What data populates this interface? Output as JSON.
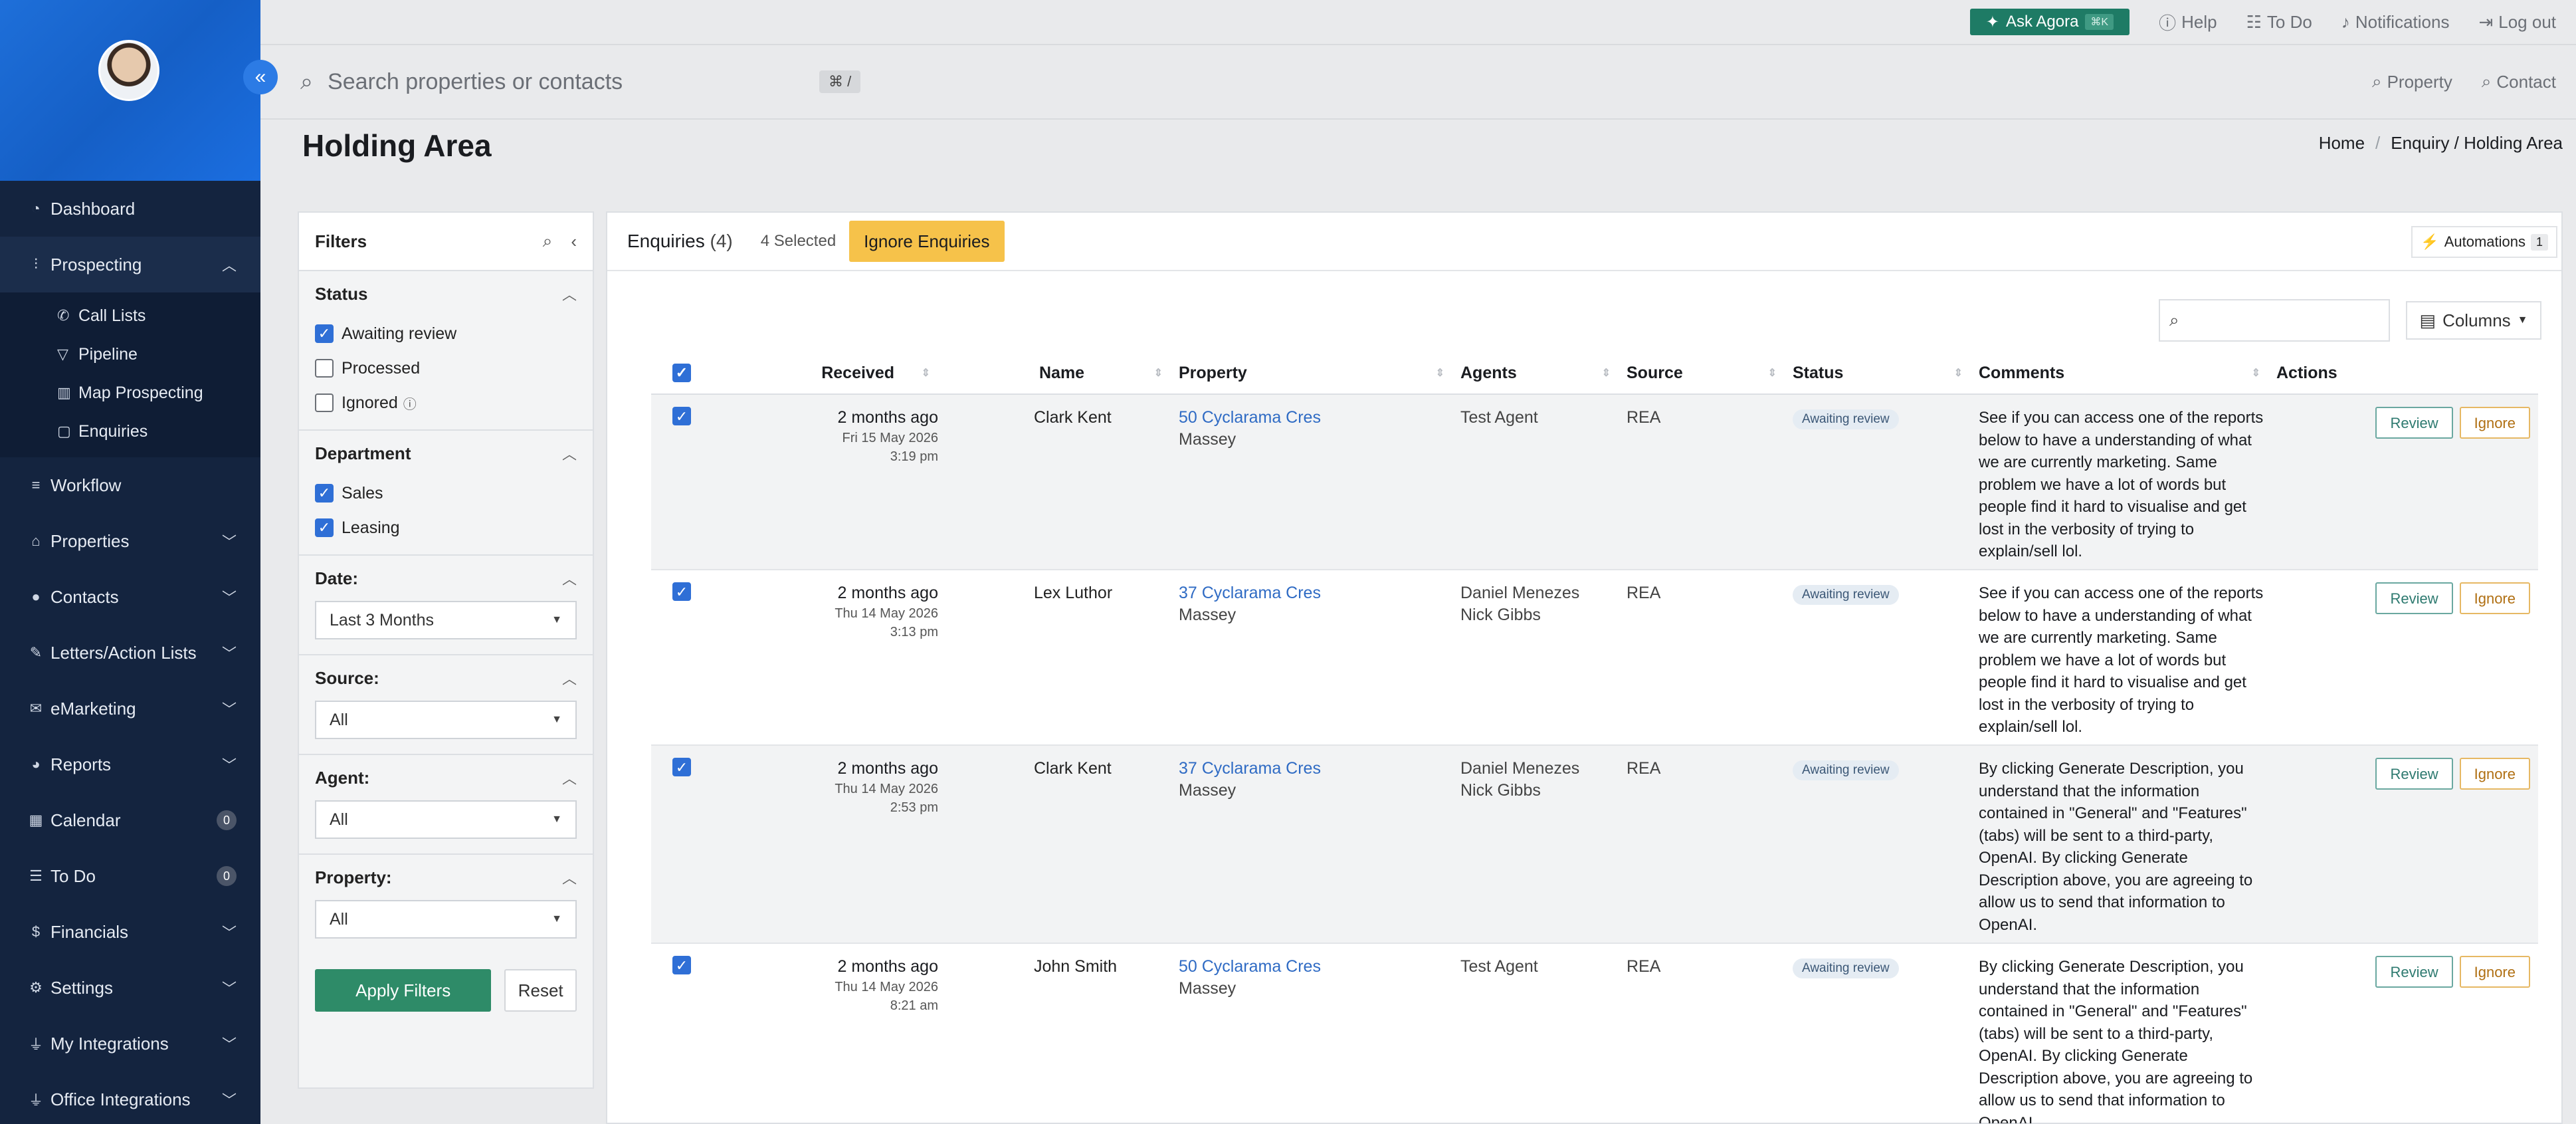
{
  "topbar": {
    "ask_label": "Ask Agora",
    "ask_shortcut": "⌘K",
    "help": "Help",
    "todo": "To Do",
    "notifications": "Notifications",
    "logout": "Log out"
  },
  "search": {
    "placeholder": "Search properties or contacts",
    "shortcut": "⌘ /",
    "property": "Property",
    "contact": "Contact"
  },
  "sidebar": {
    "items": [
      {
        "label": "Dashboard"
      },
      {
        "label": "Prospecting"
      },
      {
        "label": "Workflow"
      },
      {
        "label": "Properties"
      },
      {
        "label": "Contacts"
      },
      {
        "label": "Letters/Action Lists"
      },
      {
        "label": "eMarketing"
      },
      {
        "label": "Reports"
      },
      {
        "label": "Calendar",
        "count": "0"
      },
      {
        "label": "To Do",
        "count": "0"
      },
      {
        "label": "Financials"
      },
      {
        "label": "Settings"
      },
      {
        "label": "My Integrations"
      },
      {
        "label": "Office Integrations"
      }
    ],
    "sub": [
      {
        "label": "Call Lists"
      },
      {
        "label": "Pipeline"
      },
      {
        "label": "Map Prospecting"
      },
      {
        "label": "Enquiries"
      }
    ]
  },
  "page": {
    "title": "Holding Area",
    "breadcrumb_home": "Home",
    "breadcrumb_path": "Enquiry / Holding Area"
  },
  "filters": {
    "title": "Filters",
    "status_title": "Status",
    "status": [
      "Awaiting review",
      "Processed",
      "Ignored"
    ],
    "department_title": "Department",
    "department": [
      "Sales",
      "Leasing"
    ],
    "date_title": "Date:",
    "date_value": "Last 3 Months",
    "source_title": "Source:",
    "source_value": "All",
    "agent_title": "Agent:",
    "agent_value": "All",
    "property_title": "Property:",
    "property_value": "All",
    "apply": "Apply Filters",
    "reset": "Reset"
  },
  "main": {
    "title": "Enquiries",
    "count": "(4)",
    "selected": "4 Selected",
    "ignore_btn": "Ignore Enquiries",
    "automations": "Automations",
    "automations_count": "1",
    "columns": "Columns",
    "headers": [
      "Received",
      "Name",
      "Property",
      "Agents",
      "Source",
      "Status",
      "Comments",
      "Actions"
    ],
    "review": "Review",
    "ignore": "Ignore",
    "rows": [
      {
        "received": "2 months ago",
        "date": "Fri 15 May 2026",
        "time": "3:19 pm",
        "name": "Clark Kent",
        "property": "50 Cyclarama Cres",
        "suburb": "Massey",
        "agent1": "Test Agent",
        "agent2": "",
        "source": "REA",
        "status": "Awaiting review",
        "comment": "See if you can access one of the reports below to have a understanding of what we are currently marketing. Same problem we have a lot of words but people find it hard to visualise and get lost in the verbosity of trying to explain/sell lol."
      },
      {
        "received": "2 months ago",
        "date": "Thu 14 May 2026",
        "time": "3:13 pm",
        "name": "Lex Luthor",
        "property": "37 Cyclarama Cres",
        "suburb": "Massey",
        "agent1": "Daniel Menezes",
        "agent2": "Nick Gibbs",
        "source": "REA",
        "status": "Awaiting review",
        "comment": "See if you can access one of the reports below to have a understanding of what we are currently marketing. Same problem we have a lot of words but people find it hard to visualise and get lost in the verbosity of trying to explain/sell lol."
      },
      {
        "received": "2 months ago",
        "date": "Thu 14 May 2026",
        "time": "2:53 pm",
        "name": "Clark Kent",
        "property": "37 Cyclarama Cres",
        "suburb": "Massey",
        "agent1": "Daniel Menezes",
        "agent2": "Nick Gibbs",
        "source": "REA",
        "status": "Awaiting review",
        "comment": "By clicking Generate Description, you understand that the information contained in \"General\" and \"Features\" (tabs) will be sent to a third-party, OpenAI. By clicking Generate Description above, you are agreeing to allow us to send that information to OpenAI."
      },
      {
        "received": "2 months ago",
        "date": "Thu 14 May 2026",
        "time": "8:21 am",
        "name": "John Smith",
        "property": "50 Cyclarama Cres",
        "suburb": "Massey",
        "agent1": "Test Agent",
        "agent2": "",
        "source": "REA",
        "status": "Awaiting review",
        "comment": "By clicking Generate Description, you understand that the information contained in \"General\" and \"Features\" (tabs) will be sent to a third-party, OpenAI. By clicking Generate Description above, you are agreeing to allow us to send that information to OpenAI."
      }
    ]
  }
}
